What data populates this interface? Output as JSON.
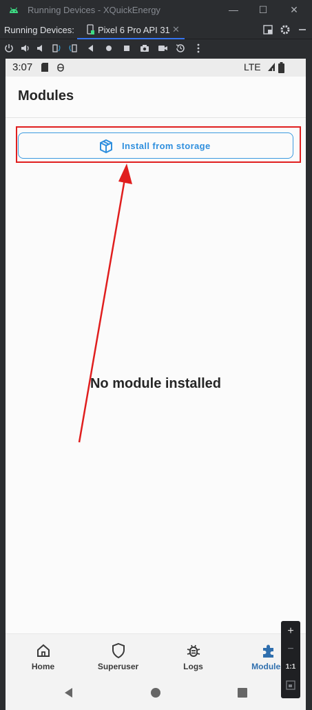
{
  "window": {
    "title": "Running Devices - XQuickEnergy"
  },
  "tabbar": {
    "label": "Running Devices:",
    "tab_title": "Pixel 6 Pro API 31",
    "tab_close": "✕"
  },
  "device": {
    "status_time": "3:07",
    "status_network": "LTE"
  },
  "app": {
    "page_title": "Modules",
    "install_button_label": "Install from storage",
    "empty_message": "No module installed",
    "nav": [
      {
        "label": "Home",
        "icon": "home-icon"
      },
      {
        "label": "Superuser",
        "icon": "shield-icon"
      },
      {
        "label": "Logs",
        "icon": "bug-icon"
      },
      {
        "label": "Modules",
        "icon": "puzzle-icon",
        "active": true
      }
    ]
  },
  "zoom": {
    "plus": "+",
    "minus": "−",
    "one_to_one": "1:1"
  },
  "colors": {
    "accent": "#2f8fde",
    "annotation": "#e01e1e",
    "active_nav": "#2f6fae"
  }
}
